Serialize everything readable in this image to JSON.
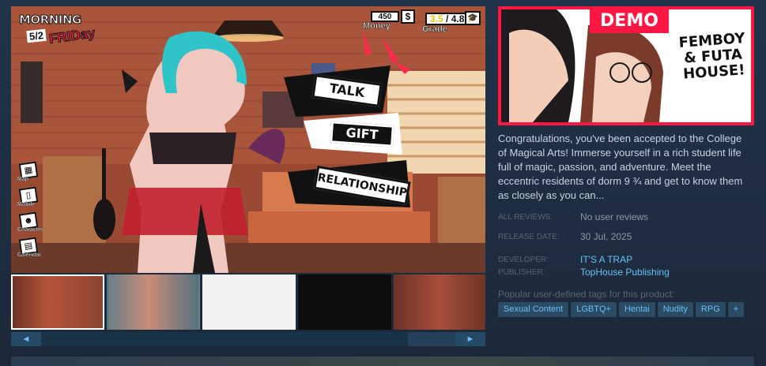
{
  "hud": {
    "logo_top": "MORNING",
    "logo_day": "5/2",
    "logo_weekday": "FRIDay",
    "money_value": "450",
    "money_label": "Money",
    "money_icon": "$",
    "grade_value": "3.5",
    "grade_max": "/ 4.8",
    "grade_label": "Grade",
    "grade_icon": "graduation-cap-icon"
  },
  "side_menu": [
    {
      "label": "Map",
      "icon": "map-icon"
    },
    {
      "label": "Mobile",
      "icon": "phone-icon"
    },
    {
      "label": "Character",
      "icon": "character-icon"
    },
    {
      "label": "Calendar",
      "icon": "calendar-icon"
    }
  ],
  "actions": {
    "talk": "TALK",
    "gift": "GIFT",
    "relationship": "RELATIONSHIP"
  },
  "thumbnails": {
    "count": 6,
    "active_index": 0
  },
  "scroll": {
    "left_arrow": "◄",
    "right_arrow": "►"
  },
  "capsule": {
    "demo_label": "DEMO",
    "title": "FEMBOY & FUTA HOUSE!"
  },
  "description": "Congratulations, you've been accepted to the College of Magical Arts! Immerse yourself in a rich student life full of magic, passion, and adventure. Meet the eccentric residents of dorm 9 ¾ and get to know them as closely as you can...",
  "info": {
    "reviews_label": "ALL REVIEWS:",
    "reviews_value": "No user reviews",
    "release_label": "RELEASE DATE:",
    "release_value": "30 Jul, 2025",
    "developer_label": "DEVELOPER:",
    "developer_value": "IT'S A TRAP",
    "publisher_label": "PUBLISHER:",
    "publisher_value": "TopHouse Publishing"
  },
  "tags_label": "Popular user-defined tags for this product:",
  "tags": [
    "Sexual Content",
    "LGBTQ+",
    "Hentai",
    "Nudity",
    "RPG",
    "+"
  ],
  "colors": {
    "page_bg": "#1b2838",
    "link": "#67c1f5",
    "text": "#c6d4df",
    "tag_bg": "#2b4a63",
    "capsule_border": "#ff1744"
  }
}
